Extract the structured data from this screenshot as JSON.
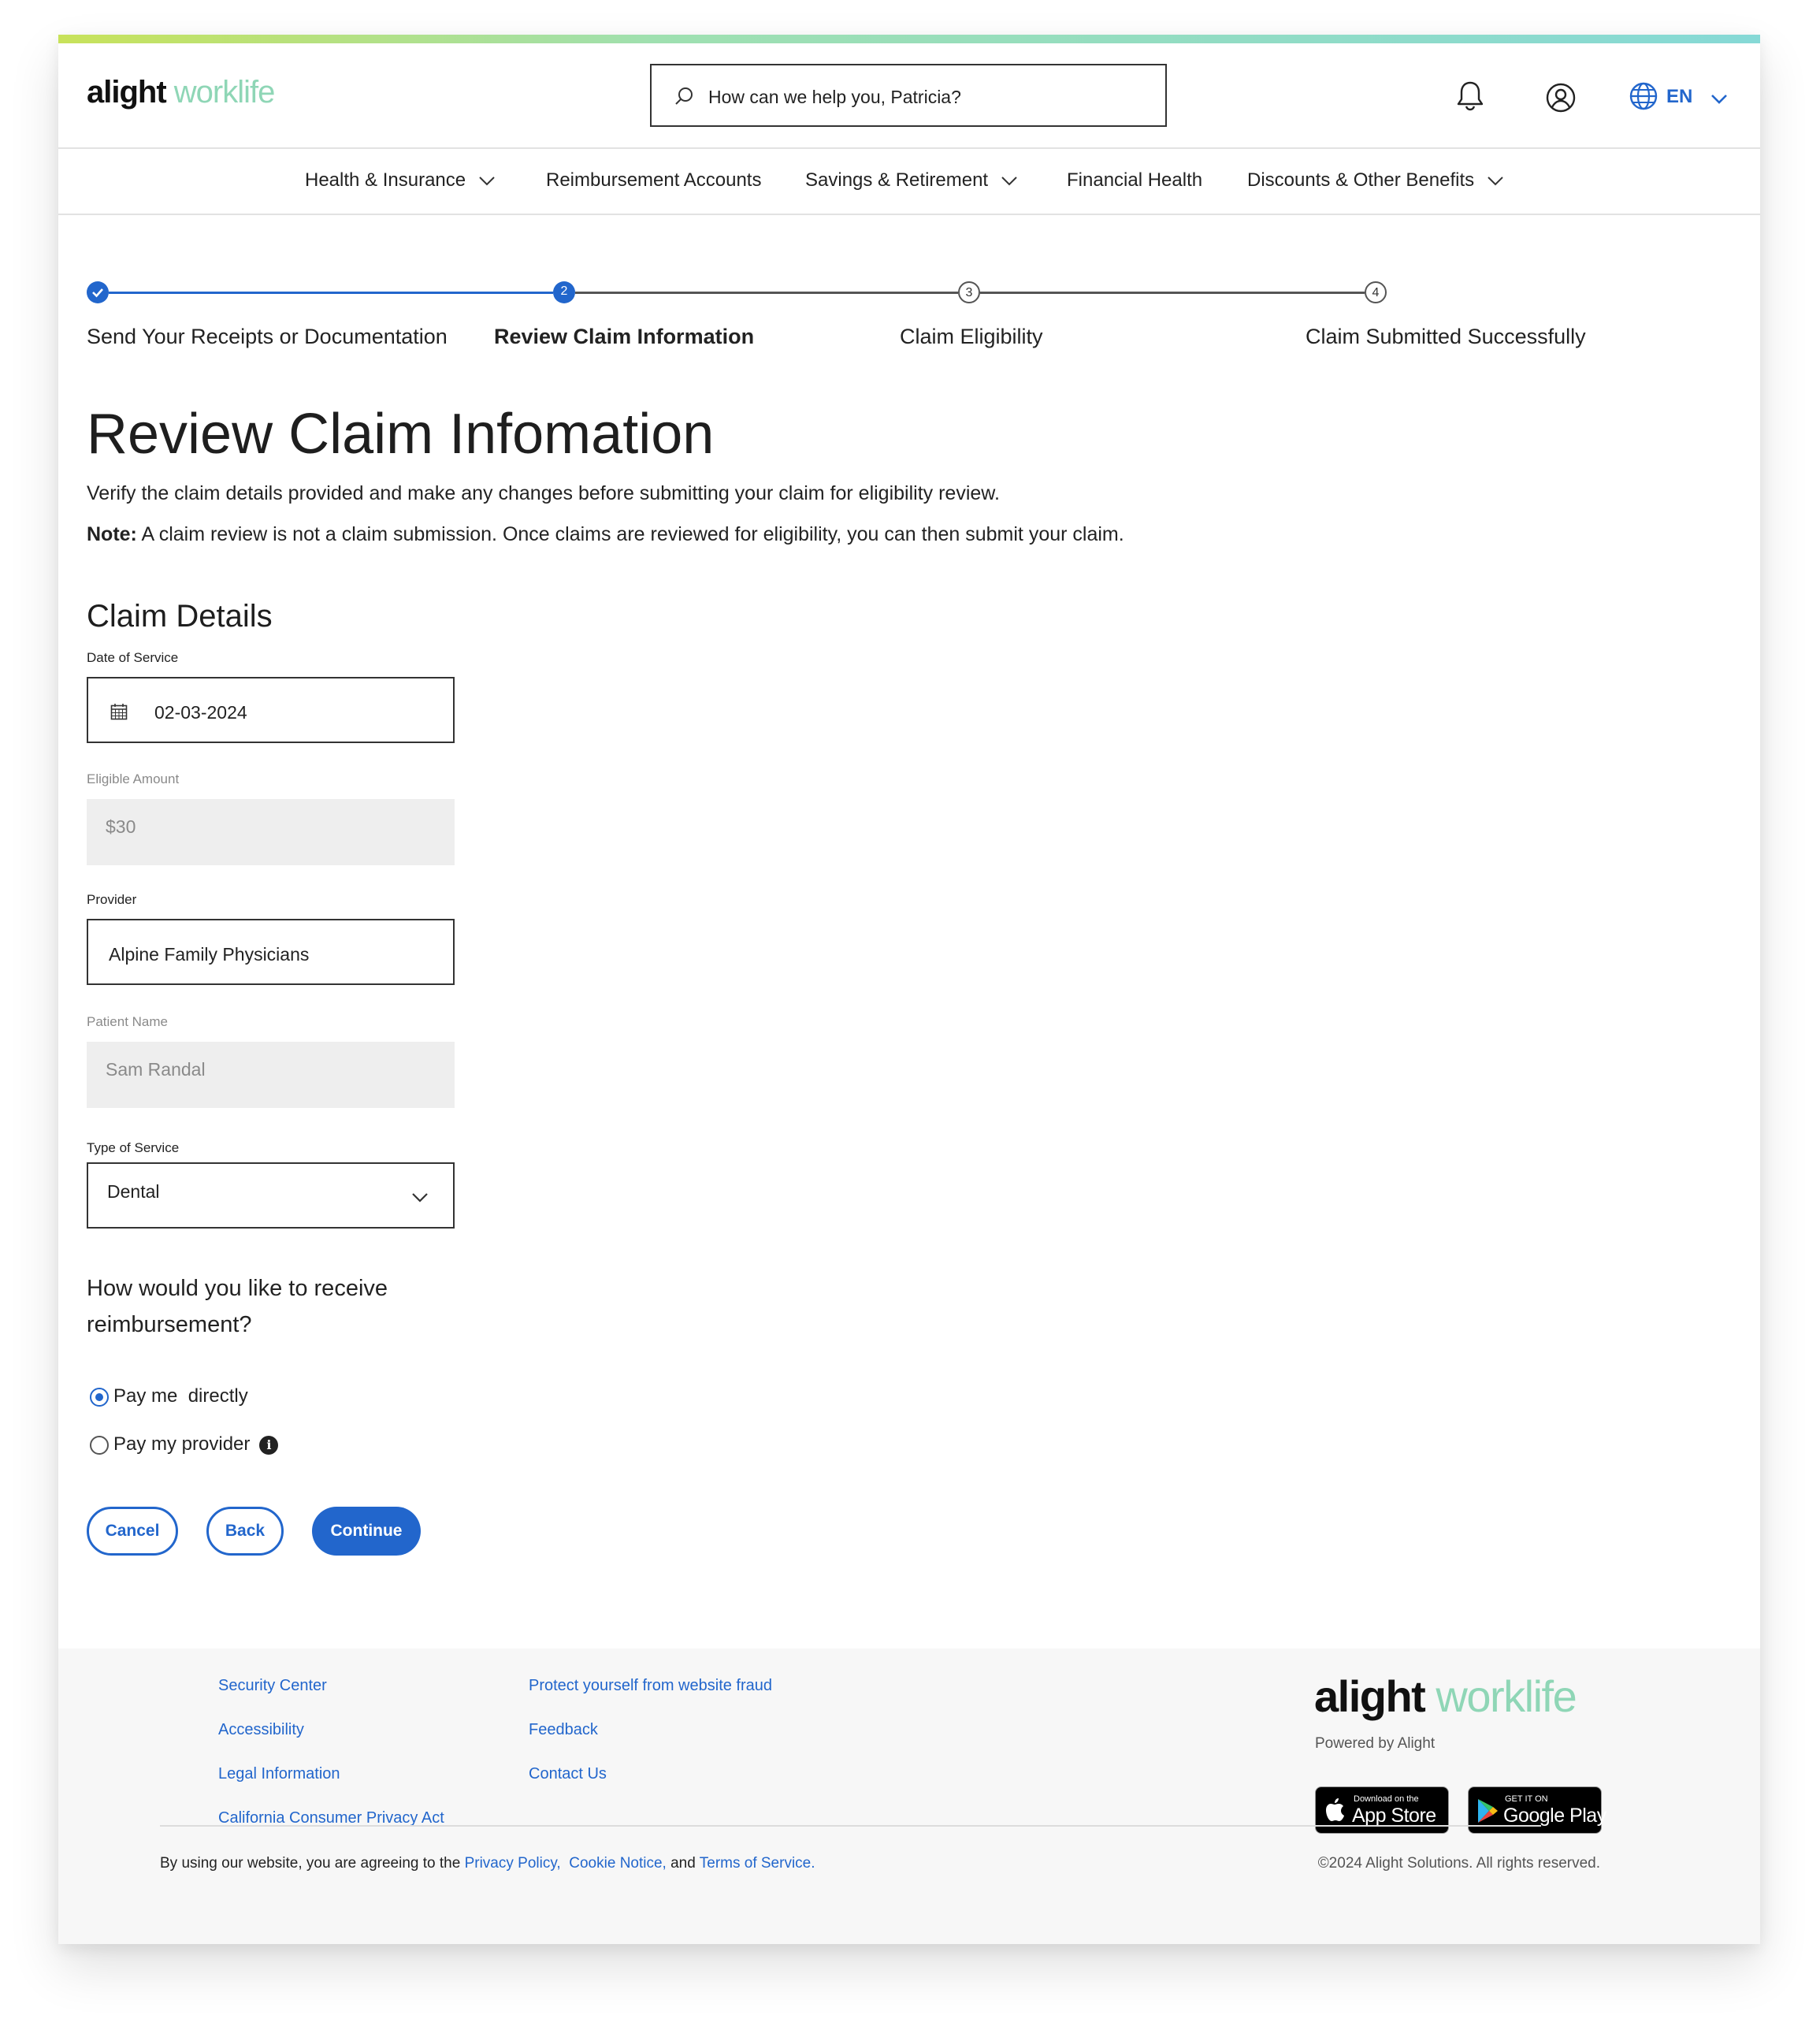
{
  "brand": {
    "logo_primary": "alight",
    "logo_secondary": "worklife",
    "accent": "#2266cc",
    "secondary_color": "#8fd6b6"
  },
  "search": {
    "placeholder": "How can we help you, Patricia?"
  },
  "header": {
    "language": "EN"
  },
  "nav": {
    "items": [
      {
        "label": "Health & Insurance",
        "has_dropdown": true
      },
      {
        "label": "Reimbursement Accounts",
        "has_dropdown": false
      },
      {
        "label": "Savings & Retirement",
        "has_dropdown": true
      },
      {
        "label": "Financial Health",
        "has_dropdown": false
      },
      {
        "label": "Discounts & Other Benefits",
        "has_dropdown": true
      }
    ]
  },
  "stepper": {
    "steps": [
      {
        "number": "1",
        "label": "Send Your Receipts or Documentation",
        "state": "complete"
      },
      {
        "number": "2",
        "label": "Review Claim Information",
        "state": "current"
      },
      {
        "number": "3",
        "label": "Claim Eligibility",
        "state": "upcoming"
      },
      {
        "number": "4",
        "label": "Claim Submitted Successfully",
        "state": "upcoming"
      }
    ]
  },
  "page": {
    "title": "Review Claim Infomation",
    "intro": "Verify the claim details provided and make any changes before submitting your claim for eligibility review.",
    "note_label": "Note:",
    "note_text": " A claim review is not a claim submission. Once claims are reviewed for eligibility, you can then submit your claim."
  },
  "claim": {
    "section_title": "Claim Details",
    "date_label": "Date of Service",
    "date_value": "02-03-2024",
    "amount_label": "Eligible Amount",
    "amount_value": "$30",
    "provider_label": "Provider",
    "provider_value": "Alpine Family Physicians",
    "patient_label": "Patient Name",
    "patient_value": "Sam Randal",
    "service_label": "Type of Service",
    "service_value": "Dental"
  },
  "reimbursement": {
    "question": "How would you like to receive reimbursement?",
    "options": [
      {
        "label": "Pay me  directly",
        "selected": true
      },
      {
        "label": "Pay my provider",
        "selected": false
      }
    ]
  },
  "actions": {
    "cancel": "Cancel",
    "back": "Back",
    "continue": "Continue"
  },
  "footer": {
    "col1": [
      "Security Center",
      "Accessibility",
      "Legal Information",
      "California Consumer Privacy Act"
    ],
    "col2": [
      "Protect yourself from website fraud",
      "Feedback",
      "Contact Us"
    ],
    "powered_by": "Powered by Alight",
    "app_store_small": "Download on the",
    "app_store_big": "App Store",
    "google_small": "GET IT ON",
    "google_big": "Google Play",
    "legal_prefix": "By using our website, you are agreeing to the ",
    "privacy_policy": "Privacy Policy,",
    "cookie_notice": "Cookie Notice,",
    "legal_and": " and ",
    "terms": "Terms of Service.",
    "copyright": "©2024 Alight Solutions. All rights reserved."
  }
}
